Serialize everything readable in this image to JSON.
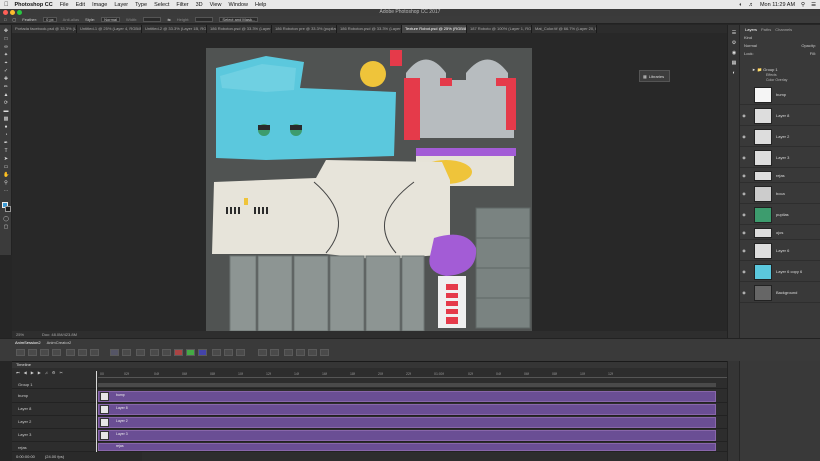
{
  "menubar": {
    "apple": "",
    "app_name": "Photoshop CC",
    "items": [
      "File",
      "Edit",
      "Image",
      "Layer",
      "Type",
      "Select",
      "Filter",
      "3D",
      "View",
      "Window",
      "Help"
    ],
    "clock": "Mon 11:29 AM"
  },
  "window_title": "Adobe Photoshop CC 2017",
  "options_bar": {
    "feather_label": "Feather:",
    "feather_value": "0 px",
    "antialias": "Anti-alias",
    "style_label": "Style:",
    "style_value": "Normal",
    "width_label": "Width:",
    "height_label": "Height:",
    "select_mask": "Select and Mask..."
  },
  "tabs": [
    {
      "label": "Portada facebook.psd @ 33.3% (Layer ...",
      "active": false
    },
    {
      "label": "Untitled-1 @ 25% (Layer 4, RGB/8...",
      "active": false
    },
    {
      "label": "Untitled-2 @ 33.3% (Layer 1B, RGB/8...",
      "active": false
    },
    {
      "label": "186 Roboton.psd @ 33.3% (Layer 1...",
      "active": false
    },
    {
      "label": "186 Roboton pre @ 33.3% (pupilas, RG...",
      "active": false
    },
    {
      "label": "186 Roboton.psd @ 33.3% (Layer 1, RG...",
      "active": false
    },
    {
      "label": "Texture Robot.psd @ 25% (RGB/8) *",
      "active": true
    },
    {
      "label": "187 Roboto @ 100% (Layer 1, RGB/...",
      "active": false
    },
    {
      "label": "Mat_Color.tif @ 66.7% (Layer 20, RGB...",
      "active": false
    }
  ],
  "status": {
    "zoom": "25%",
    "doc": "Doc: 48.0M/423.8M"
  },
  "libraries_label": "Libraries",
  "layers_panel": {
    "tabs": [
      "Layers",
      "Paths",
      "Channels"
    ],
    "kind_label": "Kind",
    "mode": "Normal",
    "opacity_label": "Opacity:",
    "lock_label": "Lock:",
    "fill_label": "Fill:",
    "layers": [
      {
        "name": "Group 1",
        "type": "group"
      },
      {
        "name": "Effects",
        "type": "effect"
      },
      {
        "name": "Color Overlay",
        "type": "effect"
      },
      {
        "name": "bump",
        "type": "layer"
      },
      {
        "name": "Layer 8",
        "type": "layer"
      },
      {
        "name": "Layer 2",
        "type": "layer"
      },
      {
        "name": "Layer 3",
        "type": "layer"
      },
      {
        "name": "rejas",
        "type": "layer"
      },
      {
        "name": "boca",
        "type": "layer"
      },
      {
        "name": "pupilas",
        "type": "layer"
      },
      {
        "name": "ojos",
        "type": "layer"
      },
      {
        "name": "Layer 6",
        "type": "layer"
      },
      {
        "name": "Layer 6 copy 6",
        "type": "layer"
      },
      {
        "name": "Background",
        "type": "layer"
      }
    ]
  },
  "anim_panel": {
    "tabs": [
      "AnimSession2",
      "AnimCreator2"
    ]
  },
  "timeline": {
    "title": "Timeline",
    "ruler": [
      "00",
      "02f",
      "04f",
      "06f",
      "08f",
      "10f",
      "12f",
      "14f",
      "16f",
      "18f",
      "20f",
      "22f",
      "01:00f",
      "02f",
      "04f",
      "06f",
      "08f",
      "10f",
      "12f"
    ],
    "tracks": [
      {
        "name": "Group 1",
        "clip": ""
      },
      {
        "name": "bump",
        "clip": "bump"
      },
      {
        "name": "Layer 8",
        "clip": "Layer 8"
      },
      {
        "name": "Layer 2",
        "clip": "Layer 2"
      },
      {
        "name": "Layer 3",
        "clip": "Layer 3"
      },
      {
        "name": "rejas",
        "clip": "rejas"
      }
    ],
    "timecode": "0:00:00:00",
    "fps": "(24.00 fps)"
  },
  "colors": {
    "clip": "#6a4e94",
    "canvas_bg": "#4f5250",
    "cyan_paint": "#5bc8dd",
    "cream_paint": "#e7e4da",
    "purple_paint": "#a35cd6",
    "red_paint": "#e53a4a",
    "yellow_paint": "#efc43a"
  }
}
